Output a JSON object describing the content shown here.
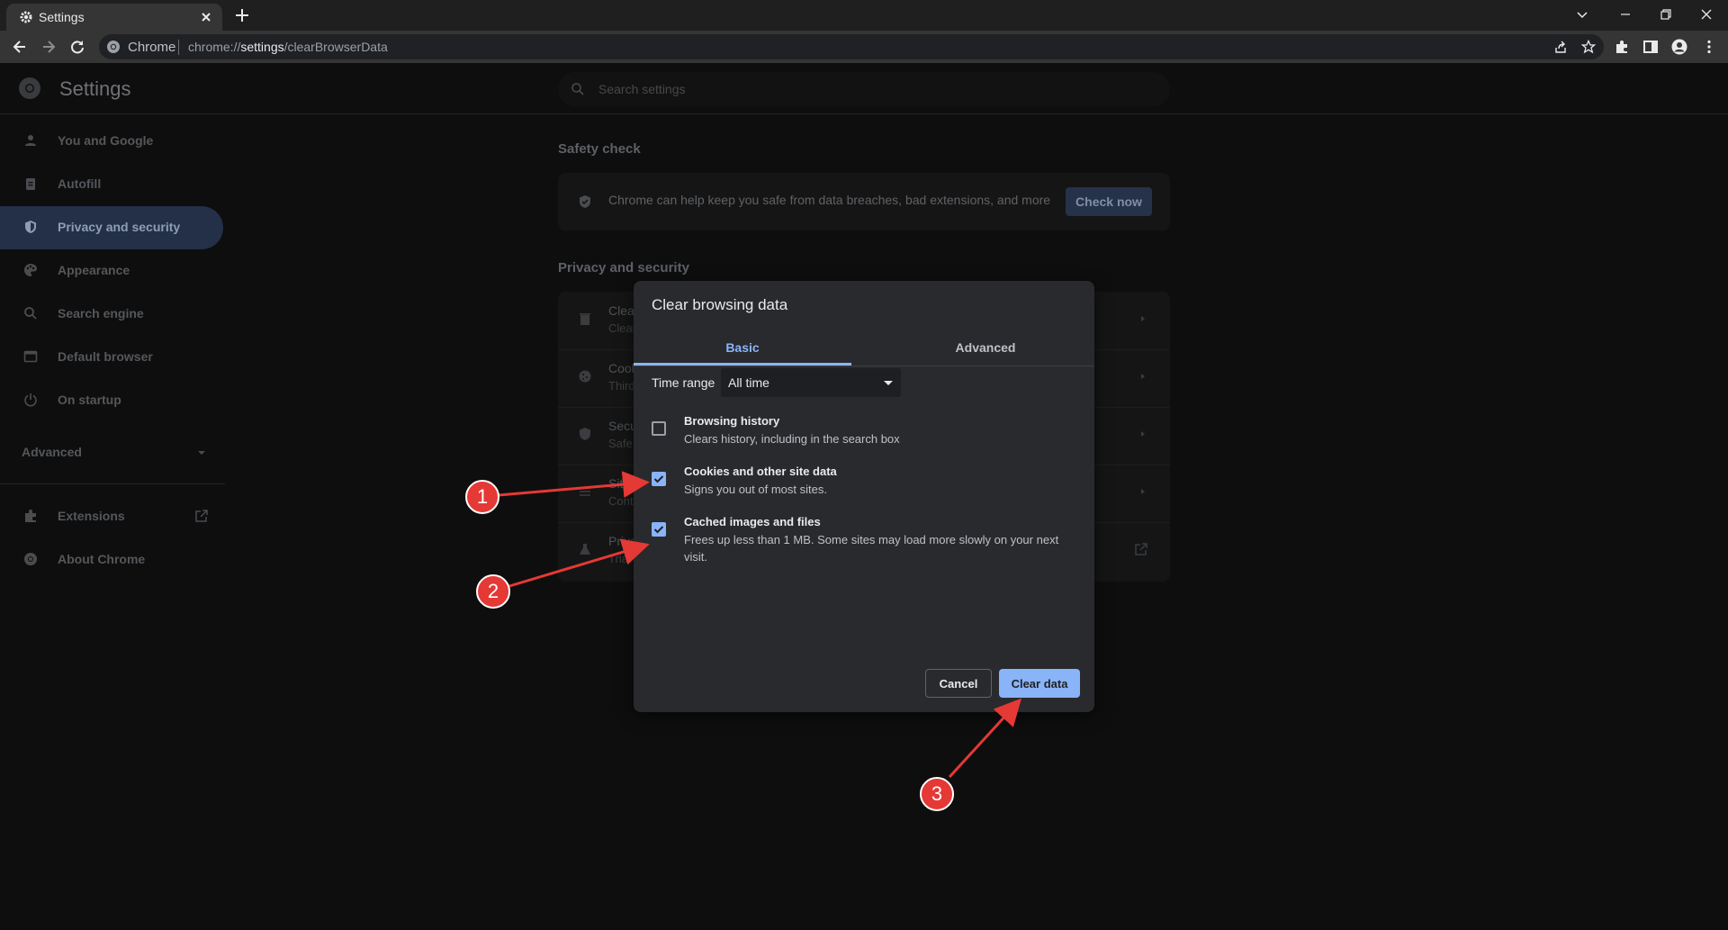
{
  "tab": {
    "title": "Settings"
  },
  "toolbar": {
    "site_label": "Chrome",
    "url_prefix": "chrome://",
    "url_host": "settings",
    "url_path": "/clearBrowserData"
  },
  "header": {
    "title": "Settings",
    "search_placeholder": "Search settings"
  },
  "sidebar": {
    "items": [
      {
        "label": "You and Google",
        "icon": "person-icon"
      },
      {
        "label": "Autofill",
        "icon": "clipboard-icon"
      },
      {
        "label": "Privacy and security",
        "icon": "shield-icon",
        "active": true
      },
      {
        "label": "Appearance",
        "icon": "palette-icon"
      },
      {
        "label": "Search engine",
        "icon": "search-icon"
      },
      {
        "label": "Default browser",
        "icon": "browser-icon"
      },
      {
        "label": "On startup",
        "icon": "power-icon"
      }
    ],
    "advanced_label": "Advanced",
    "extensions_label": "Extensions",
    "about_label": "About Chrome"
  },
  "main": {
    "safety_check_title": "Safety check",
    "safety_check_text": "Chrome can help keep you safe from data breaches, bad extensions, and more",
    "check_now_label": "Check now",
    "privacy_title": "Privacy and security",
    "rows": [
      {
        "title": "Clear",
        "subtitle": "Clear"
      },
      {
        "title": "Cook",
        "subtitle": "Third"
      },
      {
        "title": "Secu",
        "subtitle": "Safe"
      },
      {
        "title": "Site",
        "subtitle": "Cont"
      },
      {
        "title": "Priva",
        "subtitle": "Trial"
      }
    ]
  },
  "dialog": {
    "title": "Clear browsing data",
    "tabs": {
      "basic": "Basic",
      "advanced": "Advanced"
    },
    "time_range_label": "Time range",
    "time_range_value": "All time",
    "options": [
      {
        "title": "Browsing history",
        "desc": "Clears history, including in the search box",
        "checked": false
      },
      {
        "title": "Cookies and other site data",
        "desc": "Signs you out of most sites.",
        "checked": true
      },
      {
        "title": "Cached images and files",
        "desc": "Frees up less than 1 MB. Some sites may load more slowly on your next visit.",
        "checked": true
      }
    ],
    "cancel_label": "Cancel",
    "clear_label": "Clear data"
  },
  "annotations": {
    "badges": [
      "1",
      "2",
      "3"
    ],
    "color": "#e53935"
  },
  "colors": {
    "accent": "#8ab4f8",
    "annotation": "#e53935"
  }
}
